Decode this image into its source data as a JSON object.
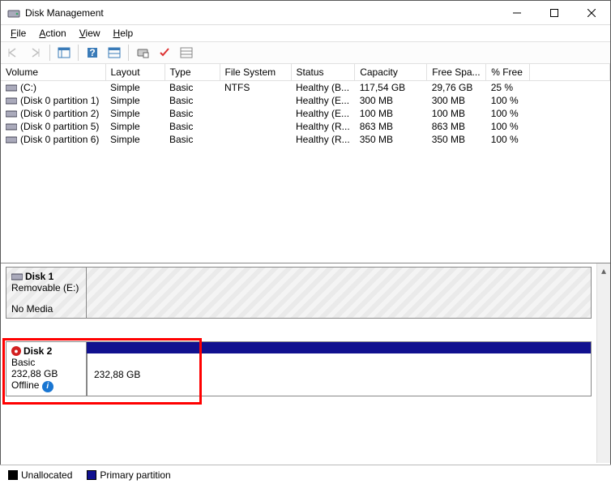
{
  "window": {
    "title": "Disk Management"
  },
  "menu": {
    "file": "File",
    "action": "Action",
    "view": "View",
    "help": "Help"
  },
  "columns": {
    "volume": "Volume",
    "layout": "Layout",
    "type": "Type",
    "fs": "File System",
    "status": "Status",
    "capacity": "Capacity",
    "free": "Free Spa...",
    "pct": "% Free"
  },
  "volumes": [
    {
      "name": "(C:)",
      "layout": "Simple",
      "type": "Basic",
      "fs": "NTFS",
      "status": "Healthy (B...",
      "capacity": "117,54 GB",
      "free": "29,76 GB",
      "pct": "25 %"
    },
    {
      "name": "(Disk 0 partition 1)",
      "layout": "Simple",
      "type": "Basic",
      "fs": "",
      "status": "Healthy (E...",
      "capacity": "300 MB",
      "free": "300 MB",
      "pct": "100 %"
    },
    {
      "name": "(Disk 0 partition 2)",
      "layout": "Simple",
      "type": "Basic",
      "fs": "",
      "status": "Healthy (E...",
      "capacity": "100 MB",
      "free": "100 MB",
      "pct": "100 %"
    },
    {
      "name": "(Disk 0 partition 5)",
      "layout": "Simple",
      "type": "Basic",
      "fs": "",
      "status": "Healthy (R...",
      "capacity": "863 MB",
      "free": "863 MB",
      "pct": "100 %"
    },
    {
      "name": "(Disk 0 partition 6)",
      "layout": "Simple",
      "type": "Basic",
      "fs": "",
      "status": "Healthy (R...",
      "capacity": "350 MB",
      "free": "350 MB",
      "pct": "100 %"
    }
  ],
  "disks": {
    "d1": {
      "name": "Disk 1",
      "line2": "Removable (E:)",
      "line3": "",
      "line4": "No Media"
    },
    "d2": {
      "name": "Disk 2",
      "line2": "Basic",
      "line3": "232,88 GB",
      "line4": "Offline",
      "partition1_size": "232,88 GB"
    }
  },
  "legend": {
    "unalloc": "Unallocated",
    "primary": "Primary partition"
  }
}
